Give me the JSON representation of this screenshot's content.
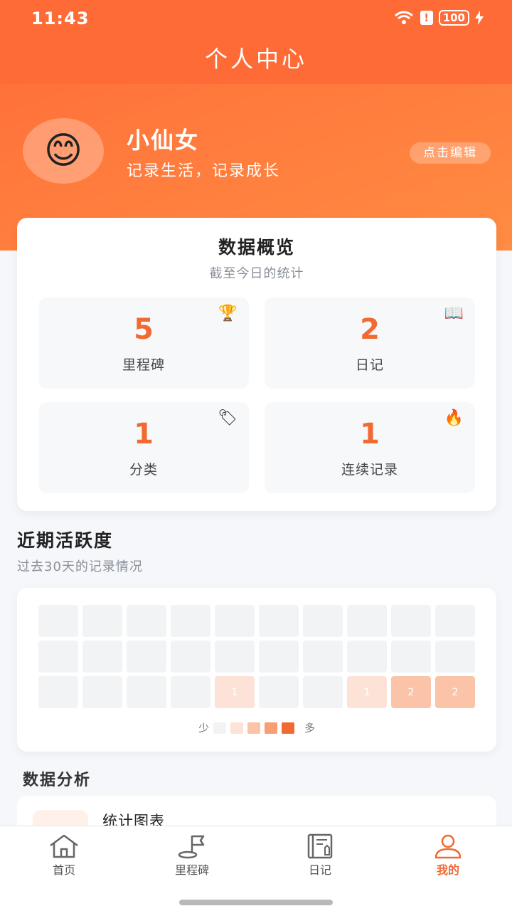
{
  "status_bar": {
    "time": "11:43",
    "battery": "100"
  },
  "header": {
    "title": "个人中心"
  },
  "profile": {
    "avatar_emoji": "😊",
    "name": "小仙女",
    "motto": "记录生活，记录成长",
    "edit_label": "点击编辑"
  },
  "overview": {
    "title": "数据概览",
    "subtitle": "截至今日的统计",
    "stats": [
      {
        "value": "5",
        "label": "里程碑",
        "icon": "trophy-icon",
        "glyph": "🏆"
      },
      {
        "value": "2",
        "label": "日记",
        "icon": "book-icon",
        "glyph": "📖"
      },
      {
        "value": "1",
        "label": "分类",
        "icon": "tag-icon",
        "glyph": "🏷"
      },
      {
        "value": "1",
        "label": "连续记录",
        "icon": "fire-icon",
        "glyph": "🔥"
      }
    ]
  },
  "activity": {
    "title": "近期活跃度",
    "subtitle": "过去30天的记录情况",
    "days": [
      0,
      0,
      0,
      0,
      0,
      0,
      0,
      0,
      0,
      0,
      0,
      0,
      0,
      0,
      0,
      0,
      0,
      0,
      0,
      0,
      0,
      0,
      0,
      0,
      1,
      0,
      0,
      1,
      2,
      2
    ],
    "legend_less": "少",
    "legend_more": "多",
    "legend_colors": [
      "#f2f3f5",
      "#fde3d7",
      "#fbc3a8",
      "#f89d74",
      "#f26a33"
    ]
  },
  "analysis": {
    "title": "数据分析",
    "item_label": "统计图表"
  },
  "tabbar": {
    "items": [
      {
        "label": "首页",
        "icon": "home-icon",
        "active": false
      },
      {
        "label": "里程碑",
        "icon": "milestone-flag-icon",
        "active": false
      },
      {
        "label": "日记",
        "icon": "diary-icon",
        "active": false
      },
      {
        "label": "我的",
        "icon": "profile-icon",
        "active": true
      }
    ]
  },
  "colors": {
    "accent": "#ff6b37",
    "number": "#f26a33"
  }
}
